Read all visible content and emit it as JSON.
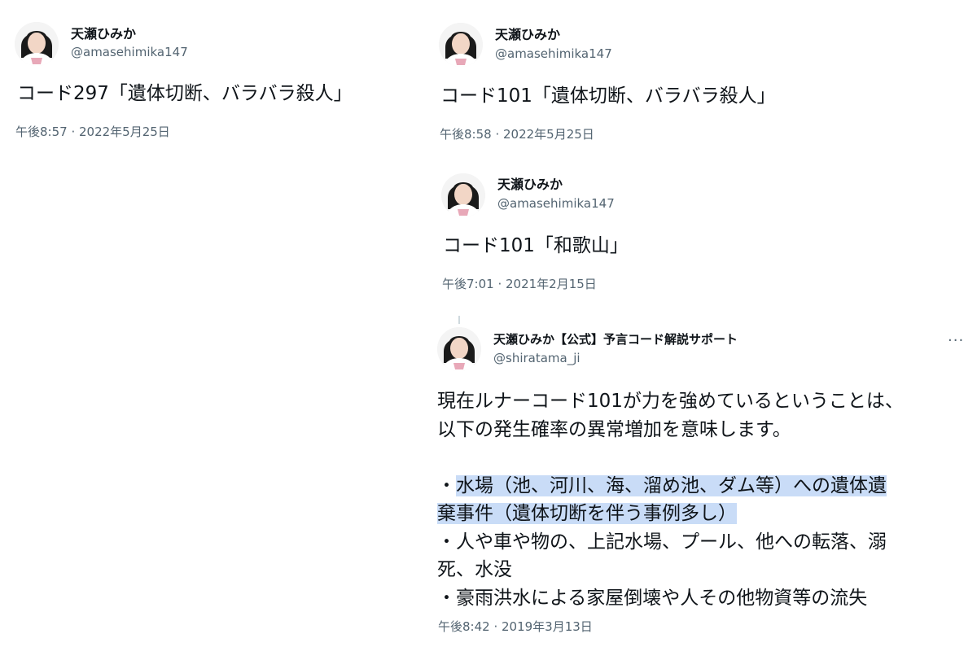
{
  "tweets": [
    {
      "name": "天瀬ひみか",
      "handle": "@amasehimika147",
      "text": "コード297「遺体切断、バラバラ殺人」",
      "date": "午後8:57 · 2022年5月25日"
    },
    {
      "name": "天瀬ひみか",
      "handle": "@amasehimika147",
      "text": "コード101「遺体切断、バラバラ殺人」",
      "date": "午後8:58 · 2022年5月25日"
    },
    {
      "name": "天瀬ひみか",
      "handle": "@amasehimika147",
      "text": "コード101「和歌山」",
      "date": "午後7:01 · 2021年2月15日"
    },
    {
      "name": "天瀬ひみか【公式】予言コード解説サポート",
      "handle": "@shiratama_ji",
      "more": "···",
      "lines": {
        "l1": "現在ルナーコード101が力を強めているということは、",
        "l2": "以下の発生確率の異常増加を意味します。",
        "l4_prefix": "・",
        "l4_hl": "水場（池、河川、海、溜め池、ダム等）への遺体遺",
        "l5_hl": "棄事件（遺体切断を伴う事例多し）",
        "l6": "・人や車や物の、上記水場、プール、他への転落、溺",
        "l7": "死、水没",
        "l8": "・豪雨洪水による家屋倒壊や人その他物資等の流失"
      },
      "date": "午後8:42 · 2019年3月13日"
    }
  ]
}
